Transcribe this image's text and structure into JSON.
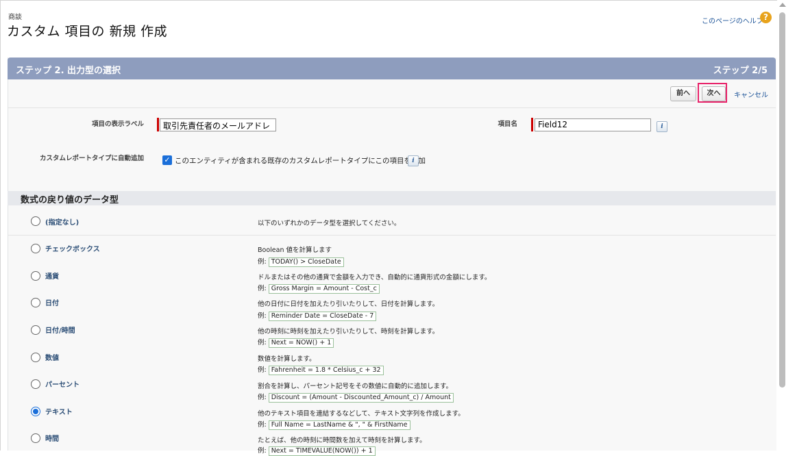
{
  "breadcrumb": "商談",
  "page_title": "カスタム 項目の 新規 作成",
  "help": {
    "link": "このページのヘルプ",
    "icon": "?"
  },
  "header": {
    "title": "ステップ 2. 出力型の選択",
    "step": "ステップ 2/5"
  },
  "buttons": {
    "prev": "前へ",
    "next": "次へ",
    "cancel": "キャンセル"
  },
  "form": {
    "label_field_label": "項目の表示ラベル",
    "label_field_value": "取引先責任者のメールアドレ",
    "name_field_label": "項目名",
    "name_field_value": "Field12",
    "auto_add_label": "カスタムレポートタイプに自動追加",
    "auto_add_checkbox": "このエンティティが含まれる既存のカスタムレポートタイプにこの項目を追加",
    "auto_add_checked": true,
    "info_icon": "i"
  },
  "section_title": "数式の戻り値のデータ型",
  "none_option": {
    "label": "(指定なし)",
    "desc": "以下のいずれかのデータ型を選択してください。"
  },
  "example_prefix": "例:",
  "types": [
    {
      "label": "チェックボックス",
      "desc": "Boolean 値を計算します",
      "example": "TODAY() > CloseDate",
      "selected": false
    },
    {
      "label": "通貨",
      "desc": "ドルまたはその他の通貨で金額を入力でき、自動的に通貨形式の金額にします。",
      "example": "Gross Margin = Amount - Cost_c",
      "selected": false
    },
    {
      "label": "日付",
      "desc": "他の日付に日付を加えたり引いたりして、日付を計算します。",
      "example": "Reminder Date = CloseDate - 7",
      "selected": false
    },
    {
      "label": "日付/時間",
      "desc": "他の時刻に時刻を加えたり引いたりして、時刻を計算します。",
      "example": "Next = NOW() + 1",
      "selected": false
    },
    {
      "label": "数値",
      "desc": "数値を計算します。",
      "example": "Fahrenheit = 1.8 * Celsius_c + 32",
      "selected": false
    },
    {
      "label": "パーセント",
      "desc": "割合を計算し、パーセント記号をその数値に自動的に追加します。",
      "example": "Discount = (Amount - Discounted_Amount_c) / Amount",
      "selected": false
    },
    {
      "label": "テキスト",
      "desc": "他のテキスト項目を連結するなどして、テキスト文字列を作成します。",
      "example": "Full Name = LastName & \", \" & FirstName",
      "selected": true
    },
    {
      "label": "時間",
      "desc": "たとえば、他の時刻に時間数を加えて時刻を計算します。",
      "example": "Next = TIMEVALUE(NOW()) + 1",
      "selected": false
    }
  ]
}
